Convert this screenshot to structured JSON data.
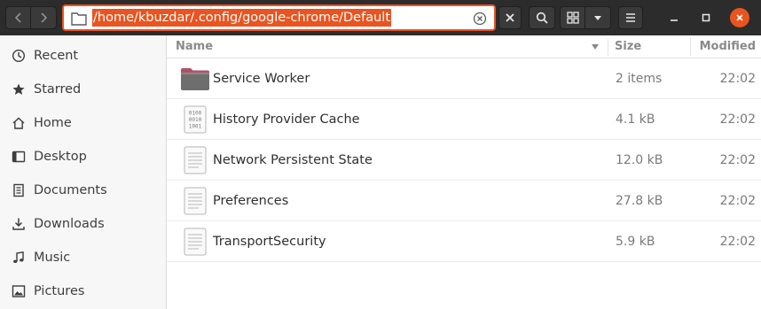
{
  "location": {
    "path": "/home/kbuzdar/.config/google-chrome/Default"
  },
  "sidebar": {
    "items": [
      {
        "label": "Recent",
        "icon": "clock-icon"
      },
      {
        "label": "Starred",
        "icon": "star-icon"
      },
      {
        "label": "Home",
        "icon": "home-icon"
      },
      {
        "label": "Desktop",
        "icon": "desktop-icon"
      },
      {
        "label": "Documents",
        "icon": "documents-icon"
      },
      {
        "label": "Downloads",
        "icon": "downloads-icon"
      },
      {
        "label": "Music",
        "icon": "music-icon"
      },
      {
        "label": "Pictures",
        "icon": "pictures-icon"
      }
    ]
  },
  "columns": {
    "name": "Name",
    "size": "Size",
    "modified": "Modified"
  },
  "files": [
    {
      "name": "Service Worker",
      "size": "2 items",
      "modified": "22:02",
      "icon": "folder-icon"
    },
    {
      "name": "History Provider Cache",
      "size": "4.1 kB",
      "modified": "22:02",
      "icon": "binary-file-icon"
    },
    {
      "name": "Network Persistent State",
      "size": "12.0 kB",
      "modified": "22:02",
      "icon": "text-file-icon"
    },
    {
      "name": "Preferences",
      "size": "27.8 kB",
      "modified": "22:02",
      "icon": "text-file-icon"
    },
    {
      "name": "TransportSecurity",
      "size": "5.9 kB",
      "modified": "22:02",
      "icon": "text-file-icon"
    }
  ],
  "colors": {
    "accent": "#e95420",
    "headerbar": "#2c2c2c",
    "sidebar": "#f7f7f7"
  }
}
